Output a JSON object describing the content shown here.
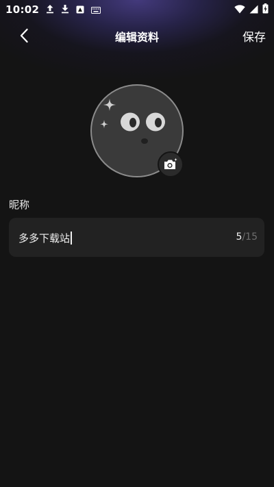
{
  "status_bar": {
    "time": "10:02",
    "left_icons": [
      "upload-icon",
      "download-icon",
      "app-notification-icon",
      "keyboard-icon"
    ],
    "right_icons": [
      "wifi-icon",
      "signal-icon",
      "battery-charging-icon"
    ]
  },
  "header": {
    "back_icon": "chevron-left-icon",
    "title": "编辑资料",
    "save_label": "保存"
  },
  "avatar": {
    "icon": "cartoon-face-avatar",
    "camera_icon": "camera-add-icon"
  },
  "form": {
    "nickname_label": "昵称",
    "nickname_value": "多多下载站",
    "count_current": "5",
    "count_max_text": "/15"
  },
  "colors": {
    "background": "#141414",
    "field_background": "#222222",
    "header_glow": "#3c3470",
    "text_primary": "#ffffff",
    "text_muted": "#6f6f6f"
  }
}
